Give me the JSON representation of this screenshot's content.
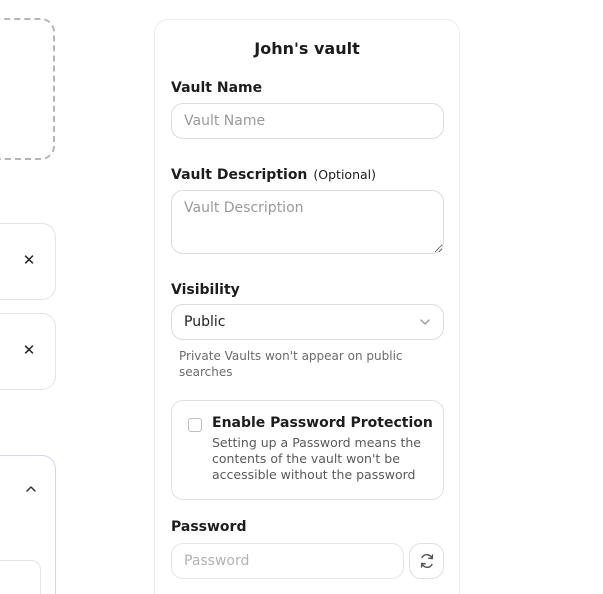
{
  "vault": {
    "title": "John's vault",
    "name_label": "Vault Name",
    "name_placeholder": "Vault Name",
    "name_value": "",
    "description_label": "Vault Description",
    "description_optional": "(Optional)",
    "description_placeholder": "Vault Description",
    "description_value": "",
    "visibility_label": "Visibility",
    "visibility_value": "Public",
    "visibility_hint": "Private Vaults won't appear on public searches",
    "password_protection": {
      "title": "Enable Password Protection",
      "description": "Setting up a Password means the contents of the vault won't be accessible without the password",
      "checked": false
    },
    "password_label": "Password",
    "password_placeholder": "Password",
    "password_value": ""
  },
  "left_column": {
    "file_cards": [
      {
        "remove_icon": "close-icon"
      },
      {
        "remove_icon": "close-icon"
      }
    ],
    "accordion_icon": "chevron-up-icon"
  },
  "icons": {
    "select_chevron": "chevron-down-icon",
    "refresh": "refresh-icon"
  },
  "colors": {
    "border": "#dcdcdc",
    "accordion_border": "#d6d3f0",
    "placeholder": "#9a9a9a"
  }
}
